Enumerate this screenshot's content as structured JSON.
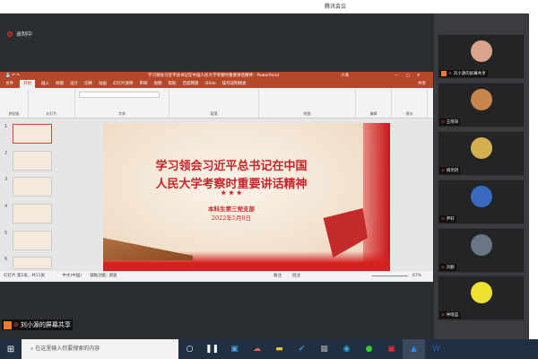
{
  "app_title": "腾讯会议",
  "recording": "录制中",
  "ppt": {
    "title": "学习领会习近平总书记在中国人民大学考察时重要讲话精神 - PowerPoint",
    "user": "小泽",
    "tabs": [
      "文件",
      "开始",
      "插入",
      "绘图",
      "设计",
      "切换",
      "动画",
      "幻灯片放映",
      "审阅",
      "视图",
      "帮助",
      "百度网盘",
      "iSlide",
      "操作说明搜索"
    ],
    "share": "共享",
    "groups": [
      "剪贴板",
      "幻灯片",
      "字体",
      "段落",
      "绘图",
      "编辑",
      "保存"
    ],
    "slide": {
      "line1": "学习领会习近平总书记在中国",
      "line2": "人民大学考察时重要讲话精神",
      "stars": "★ ★ ★",
      "org": "本科生第三党支部",
      "date": "2022年5月8日"
    },
    "thumb_numbers": [
      "1",
      "2",
      "3",
      "4",
      "5",
      "6"
    ],
    "status": {
      "slide": "幻灯片 第1张，共11张",
      "lang": "中文(中国)",
      "access": "辅助功能: 调查",
      "notes": "备注",
      "comments": "批注",
      "zoom": "67%"
    }
  },
  "participants": [
    {
      "name": "刘小源的屏幕共享",
      "color": "#d9a58a"
    },
    {
      "name": "王晓琦",
      "color": "#c8844a"
    },
    {
      "name": "胡玥玥",
      "color": "#d4b050"
    },
    {
      "name": "尹轩",
      "color": "#3a6ac0"
    },
    {
      "name": "刘鹏",
      "color": "#6a7585"
    },
    {
      "name": "仲晓蓝",
      "color": "#f0e030"
    }
  ],
  "share_label": "刘小源的屏幕共享",
  "taskbar": {
    "search_placeholder": "在这里输入你要搜索的内容"
  }
}
